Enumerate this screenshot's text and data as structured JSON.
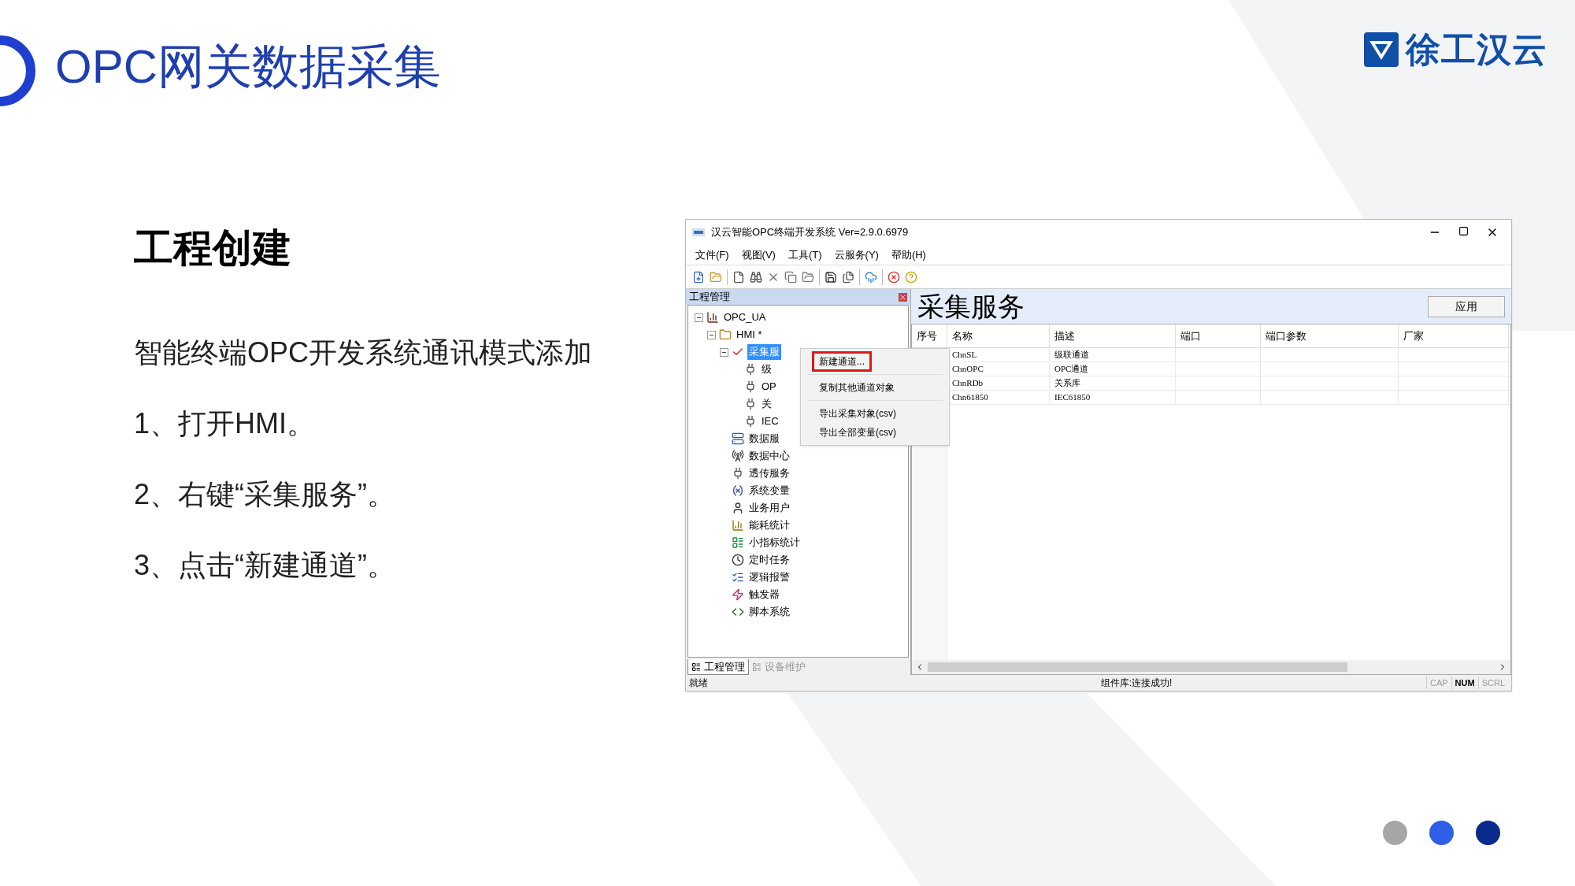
{
  "slide": {
    "title": "OPC网关数据采集",
    "logo": "徐工汉云",
    "heading": "工程创建",
    "paragraphs": [
      "智能终端OPC开发系统通讯模式添加",
      "1、打开HMI。",
      "2、右键“采集服务”。",
      "3、点击“新建通道”。"
    ],
    "pager": [
      {
        "color": "#a6a6a6"
      },
      {
        "color": "#2f5fe6"
      },
      {
        "color": "#0a2a8c"
      }
    ]
  },
  "window": {
    "title": "汉云智能OPC终端开发系统 Ver=2.9.0.6979",
    "menu": [
      "文件(F)",
      "视图(V)",
      "工具(T)",
      "云服务(Y)",
      "帮助(H)"
    ],
    "left_panel": {
      "title": "工程管理",
      "tree": [
        {
          "label": "OPC_UA",
          "expanded": true,
          "children": [
            {
              "label": "HMI *",
              "expanded": true,
              "children": [
                {
                  "label": "采集服",
                  "selected": true,
                  "expanded": true,
                  "children": [
                    {
                      "label": "级",
                      "selected": false
                    },
                    {
                      "label": "OP",
                      "selected": false
                    },
                    {
                      "label": "关",
                      "selected": false
                    },
                    {
                      "label": "IEC",
                      "selected": false
                    }
                  ]
                },
                {
                  "label": "数据服",
                  "selected": false
                },
                {
                  "label": "数据中心",
                  "selected": false
                },
                {
                  "label": "透传服务",
                  "selected": false
                },
                {
                  "label": "系统变量",
                  "selected": false
                },
                {
                  "label": "业务用户",
                  "selected": false
                },
                {
                  "label": "能耗统计",
                  "selected": false
                },
                {
                  "label": "小指标统计",
                  "selected": false
                },
                {
                  "label": "定时任务",
                  "selected": false
                },
                {
                  "label": "逻辑报警",
                  "selected": false
                },
                {
                  "label": "触发器",
                  "selected": false
                },
                {
                  "label": "脚本系统",
                  "selected": false
                }
              ]
            }
          ]
        }
      ],
      "tabs": [
        {
          "label": "工程管理",
          "selected": true
        },
        {
          "label": "设备维护",
          "selected": false
        }
      ]
    },
    "context_menu": [
      {
        "label": "新建通道...",
        "highlighted": true
      },
      {
        "label": "复制其他通道对象",
        "highlighted": false
      },
      {
        "label": "导出采集对象(csv)",
        "highlighted": false
      },
      {
        "label": "导出全部变量(csv)",
        "highlighted": false
      }
    ],
    "right_panel": {
      "title": "采集服务",
      "apply_button": "应用",
      "table": {
        "columns": [
          "序号",
          "名称",
          "描述",
          "端口",
          "端口参数",
          "厂家"
        ],
        "rows": [
          [
            "",
            "ChnSL",
            "级联通道",
            "",
            "",
            ""
          ],
          [
            "",
            "ChnOPC",
            "OPC通道",
            "",
            "",
            ""
          ],
          [
            "",
            "ChnRDb",
            "关系库",
            "",
            "",
            ""
          ],
          [
            "",
            "Chn61850",
            "IEC61850",
            "",
            "",
            ""
          ]
        ]
      }
    },
    "status_bar": {
      "left": "就绪",
      "center": "组件库:连接成功!",
      "indicators": [
        {
          "label": "CAP",
          "on": false
        },
        {
          "label": "NUM",
          "on": true
        },
        {
          "label": "SCRL",
          "on": false
        }
      ]
    }
  }
}
